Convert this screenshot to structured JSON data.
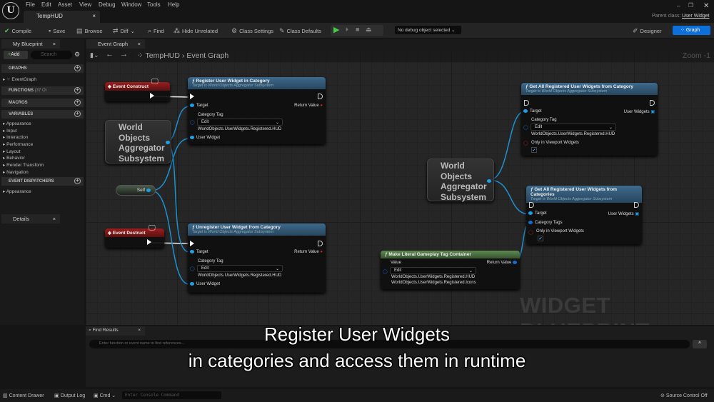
{
  "menu": [
    "File",
    "Edit",
    "Asset",
    "View",
    "Debug",
    "Window",
    "Tools",
    "Help"
  ],
  "doc_tab": "TempHUD",
  "parent_class_label": "Parent class:",
  "parent_class": "User Widget",
  "toolbar": {
    "compile": "Compile",
    "save": "Save",
    "browse": "Browse",
    "diff": "Diff",
    "find": "Find",
    "hide_unrelated": "Hide Unrelated",
    "class_settings": "Class Settings",
    "class_defaults": "Class Defaults",
    "debug_select": "No debug object selected",
    "designer": "Designer",
    "graph": "Graph"
  },
  "my_blueprint": {
    "tab": "My Blueprint",
    "add": "Add",
    "search_placeholder": "Search",
    "graphs": "GRAPHS",
    "event_graph": "EventGraph",
    "functions": "FUNCTIONS",
    "functions_count": "(37 O\\",
    "macros": "MACROS",
    "variables": "VARIABLES",
    "variable_items": [
      "Appearance",
      "Input",
      "Interaction",
      "Performance",
      "Layout",
      "Behavior",
      "Render Transform",
      "Navigation"
    ],
    "event_dispatchers": "EVENT DISPATCHERS",
    "dispatcher_items": [
      "Appearance"
    ]
  },
  "details_tab": "Details",
  "graph": {
    "tab": "Event Graph",
    "breadcrumb": [
      "TempHUD",
      "Event Graph"
    ],
    "zoom": "Zoom -1",
    "watermark": "WIDGET BLUEPRINT",
    "nodes": {
      "event_construct": "Event Construct",
      "event_destruct": "Event Destruct",
      "woas": [
        "World",
        "Objects",
        "Aggregator",
        "Subsystem"
      ],
      "self": "Self",
      "register": {
        "title": "Register User Widget in Category",
        "subtitle": "Target is World Objects Aggregator Subsystem",
        "target": "Target",
        "category_tag": "Category Tag",
        "edit": "Edit",
        "tag_value": "WorldObjects.UserWidgets.Registered.HUD",
        "user_widget": "User Widget",
        "return_value": "Return Value"
      },
      "unregister": {
        "title": "Unregister User Widget from Category",
        "subtitle": "Target is World Objects Aggregator Subsystem",
        "target": "Target",
        "category_tag": "Category Tag",
        "edit": "Edit",
        "tag_value": "WorldObjects.UserWidgets.Registered.HUD",
        "user_widget": "User Widget",
        "return_value": "Return Value"
      },
      "get_category": {
        "title": "Get All Registered User Widgets from Category",
        "subtitle": "Target is World Objects Aggregator Subsystem",
        "target": "Target",
        "user_widgets": "User Widgets",
        "category_tag": "Category Tag",
        "edit": "Edit",
        "tag_value": "WorldObjects.UserWidgets.Registered.HUD",
        "only_viewport": "Only in Viewport Widgets",
        "checked": true
      },
      "get_categories": {
        "title": "Get All Registered User Widgets from Categories",
        "subtitle": "Target is World Objects Aggregator Subsystem",
        "target": "Target",
        "user_widgets": "User Widgets",
        "category_tags": "Category Tags",
        "only_viewport": "Only in Viewport Widgets",
        "checked": true
      },
      "make_literal": {
        "title": "Make Literal Gameplay Tag Container",
        "value": "Value",
        "return_value": "Return Value",
        "edit": "Edit",
        "tags": [
          "WorldObjects.UserWidgets.Registered.HUD",
          "WorldObjects.UserWidgets.Registered.Icons"
        ]
      }
    }
  },
  "find_results": {
    "tab": "Find Results",
    "placeholder": "Enter function or event name to find references..."
  },
  "caption": [
    "Register User Widgets",
    "in categories and access them in runtime"
  ],
  "statusbar": {
    "content_drawer": "Content Drawer",
    "output_log": "Output Log",
    "cmd": "Cmd",
    "console_placeholder": "Enter Console Command",
    "source_control": "Source Control Off"
  },
  "colors": {
    "accent": "#0e6fdb",
    "function_header": "#3d6a8c",
    "event_header": "#8c1a1a",
    "pure_header": "#4f7a45",
    "data_pin": "#1ea0e6"
  }
}
